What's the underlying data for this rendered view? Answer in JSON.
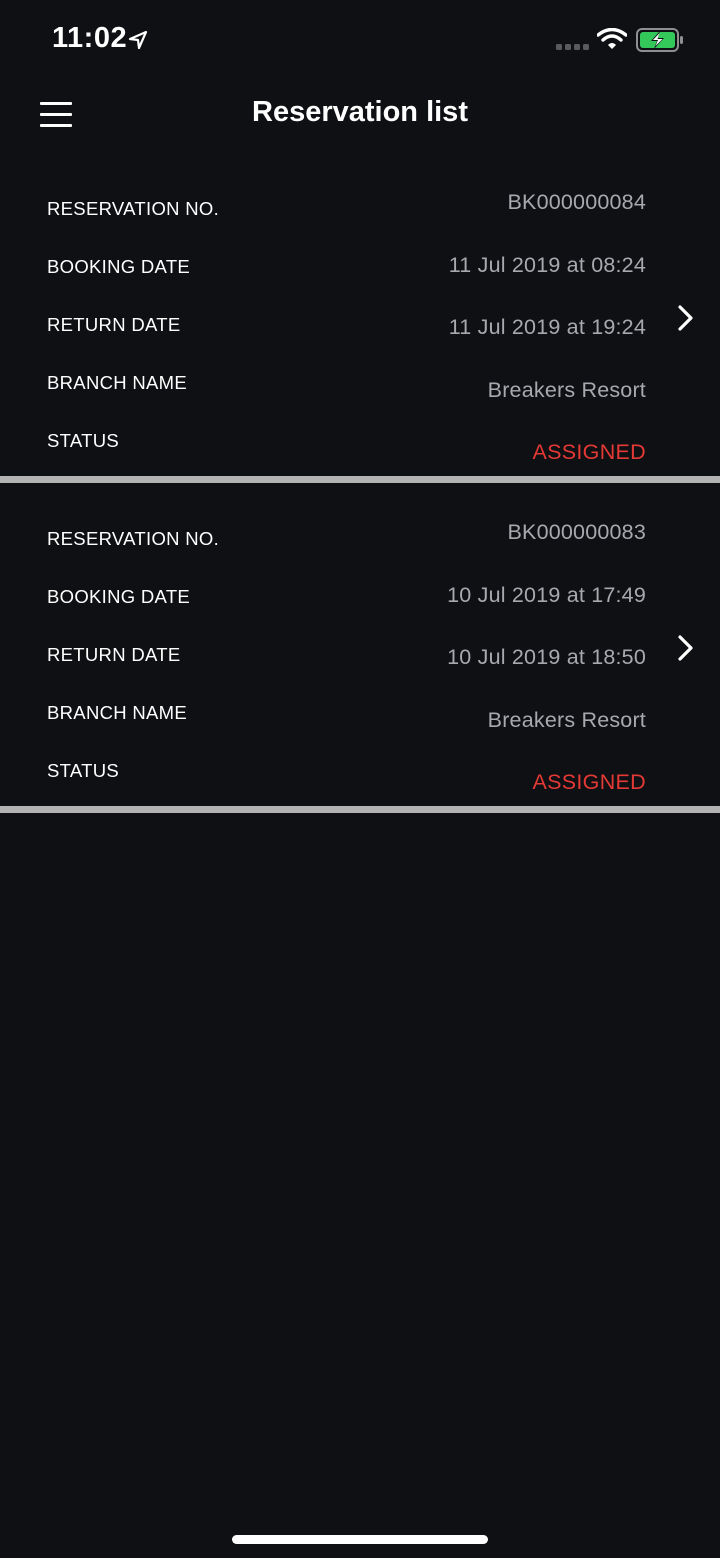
{
  "status_bar": {
    "time": "11:02",
    "icons": [
      "location-arrow-icon",
      "signal-icon",
      "wifi-icon",
      "battery-charging-icon"
    ],
    "battery_color": "#34c759"
  },
  "header": {
    "title": "Reservation list",
    "menu_icon": "hamburger-menu-icon"
  },
  "colors": {
    "background": "#0f1014",
    "label": "#ffffff",
    "value": "#a7a9ae",
    "status_assigned": "#e53935",
    "divider": "#b3b3b3"
  },
  "reservations": [
    {
      "labels": {
        "reservation_no": "RESERVATION NO.",
        "booking_date": "BOOKING DATE",
        "return_date": "RETURN DATE",
        "branch_name": "BRANCH NAME",
        "status": "STATUS"
      },
      "reservation_no": "BK000000084",
      "booking_date": "11 Jul 2019 at 08:24",
      "return_date": "11 Jul 2019 at 19:24",
      "branch_name": "Breakers Resort",
      "status": "ASSIGNED"
    },
    {
      "labels": {
        "reservation_no": "RESERVATION NO.",
        "booking_date": "BOOKING DATE",
        "return_date": "RETURN DATE",
        "branch_name": "BRANCH NAME",
        "status": "STATUS"
      },
      "reservation_no": "BK000000083",
      "booking_date": "10 Jul 2019 at 17:49",
      "return_date": "10 Jul 2019 at 18:50",
      "branch_name": "Breakers Resort",
      "status": "ASSIGNED"
    }
  ]
}
